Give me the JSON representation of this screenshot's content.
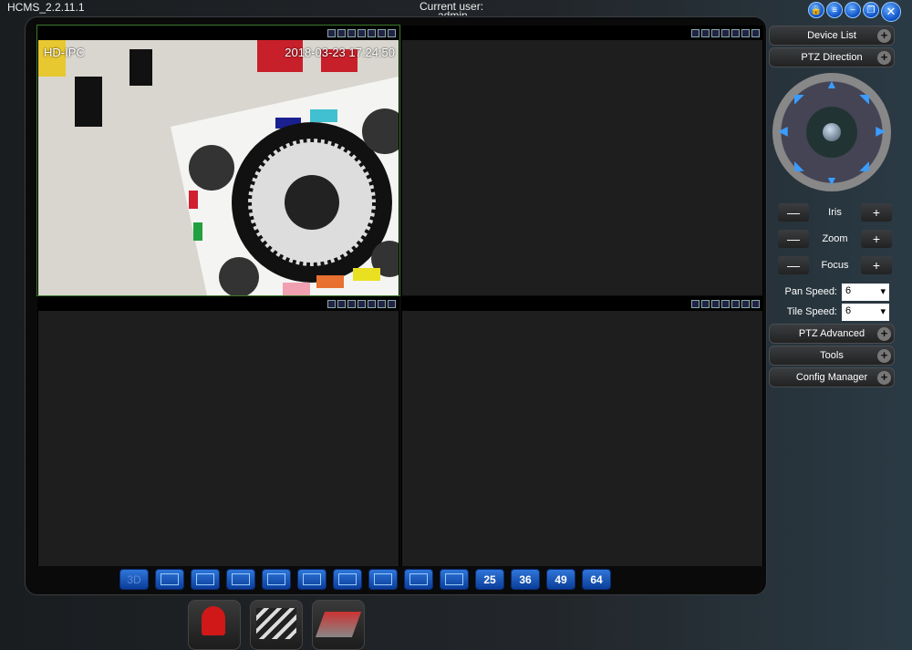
{
  "window": {
    "title": "HCMS_2.2.11.1",
    "user_label": "Current user:",
    "user_name": "admin"
  },
  "window_buttons": [
    {
      "icon": "lock-icon",
      "g": "🔒"
    },
    {
      "icon": "menu-icon",
      "g": "≡"
    },
    {
      "icon": "minimize-icon",
      "g": "−"
    },
    {
      "icon": "restore-icon",
      "g": "❐"
    },
    {
      "icon": "close-icon",
      "g": "✕"
    }
  ],
  "video": {
    "channel": "HD-IPC",
    "timestamp": "2018-03-23  17:24:50"
  },
  "layout_buttons": [
    "3D",
    "",
    "",
    "",
    "",
    "",
    "",
    "",
    "",
    "",
    "25",
    "36",
    "49",
    "64"
  ],
  "apps": [
    {
      "name": "alarm-app"
    },
    {
      "name": "record-app"
    },
    {
      "name": "backup-app"
    }
  ],
  "side": {
    "device_list": "Device List",
    "ptz_direction": "PTZ Direction",
    "iris": "Iris",
    "zoom": "Zoom",
    "focus": "Focus",
    "pan_speed_label": "Pan Speed:",
    "pan_speed": "6",
    "tile_speed_label": "Tile Speed:",
    "tile_speed": "6",
    "ptz_advanced": "PTZ Advanced",
    "tools": "Tools",
    "config_manager": "Config Manager",
    "minus": "—",
    "plus": "+"
  },
  "colors": {
    "accent": "#1e6ad8",
    "active_border": "#3a7a2a"
  }
}
